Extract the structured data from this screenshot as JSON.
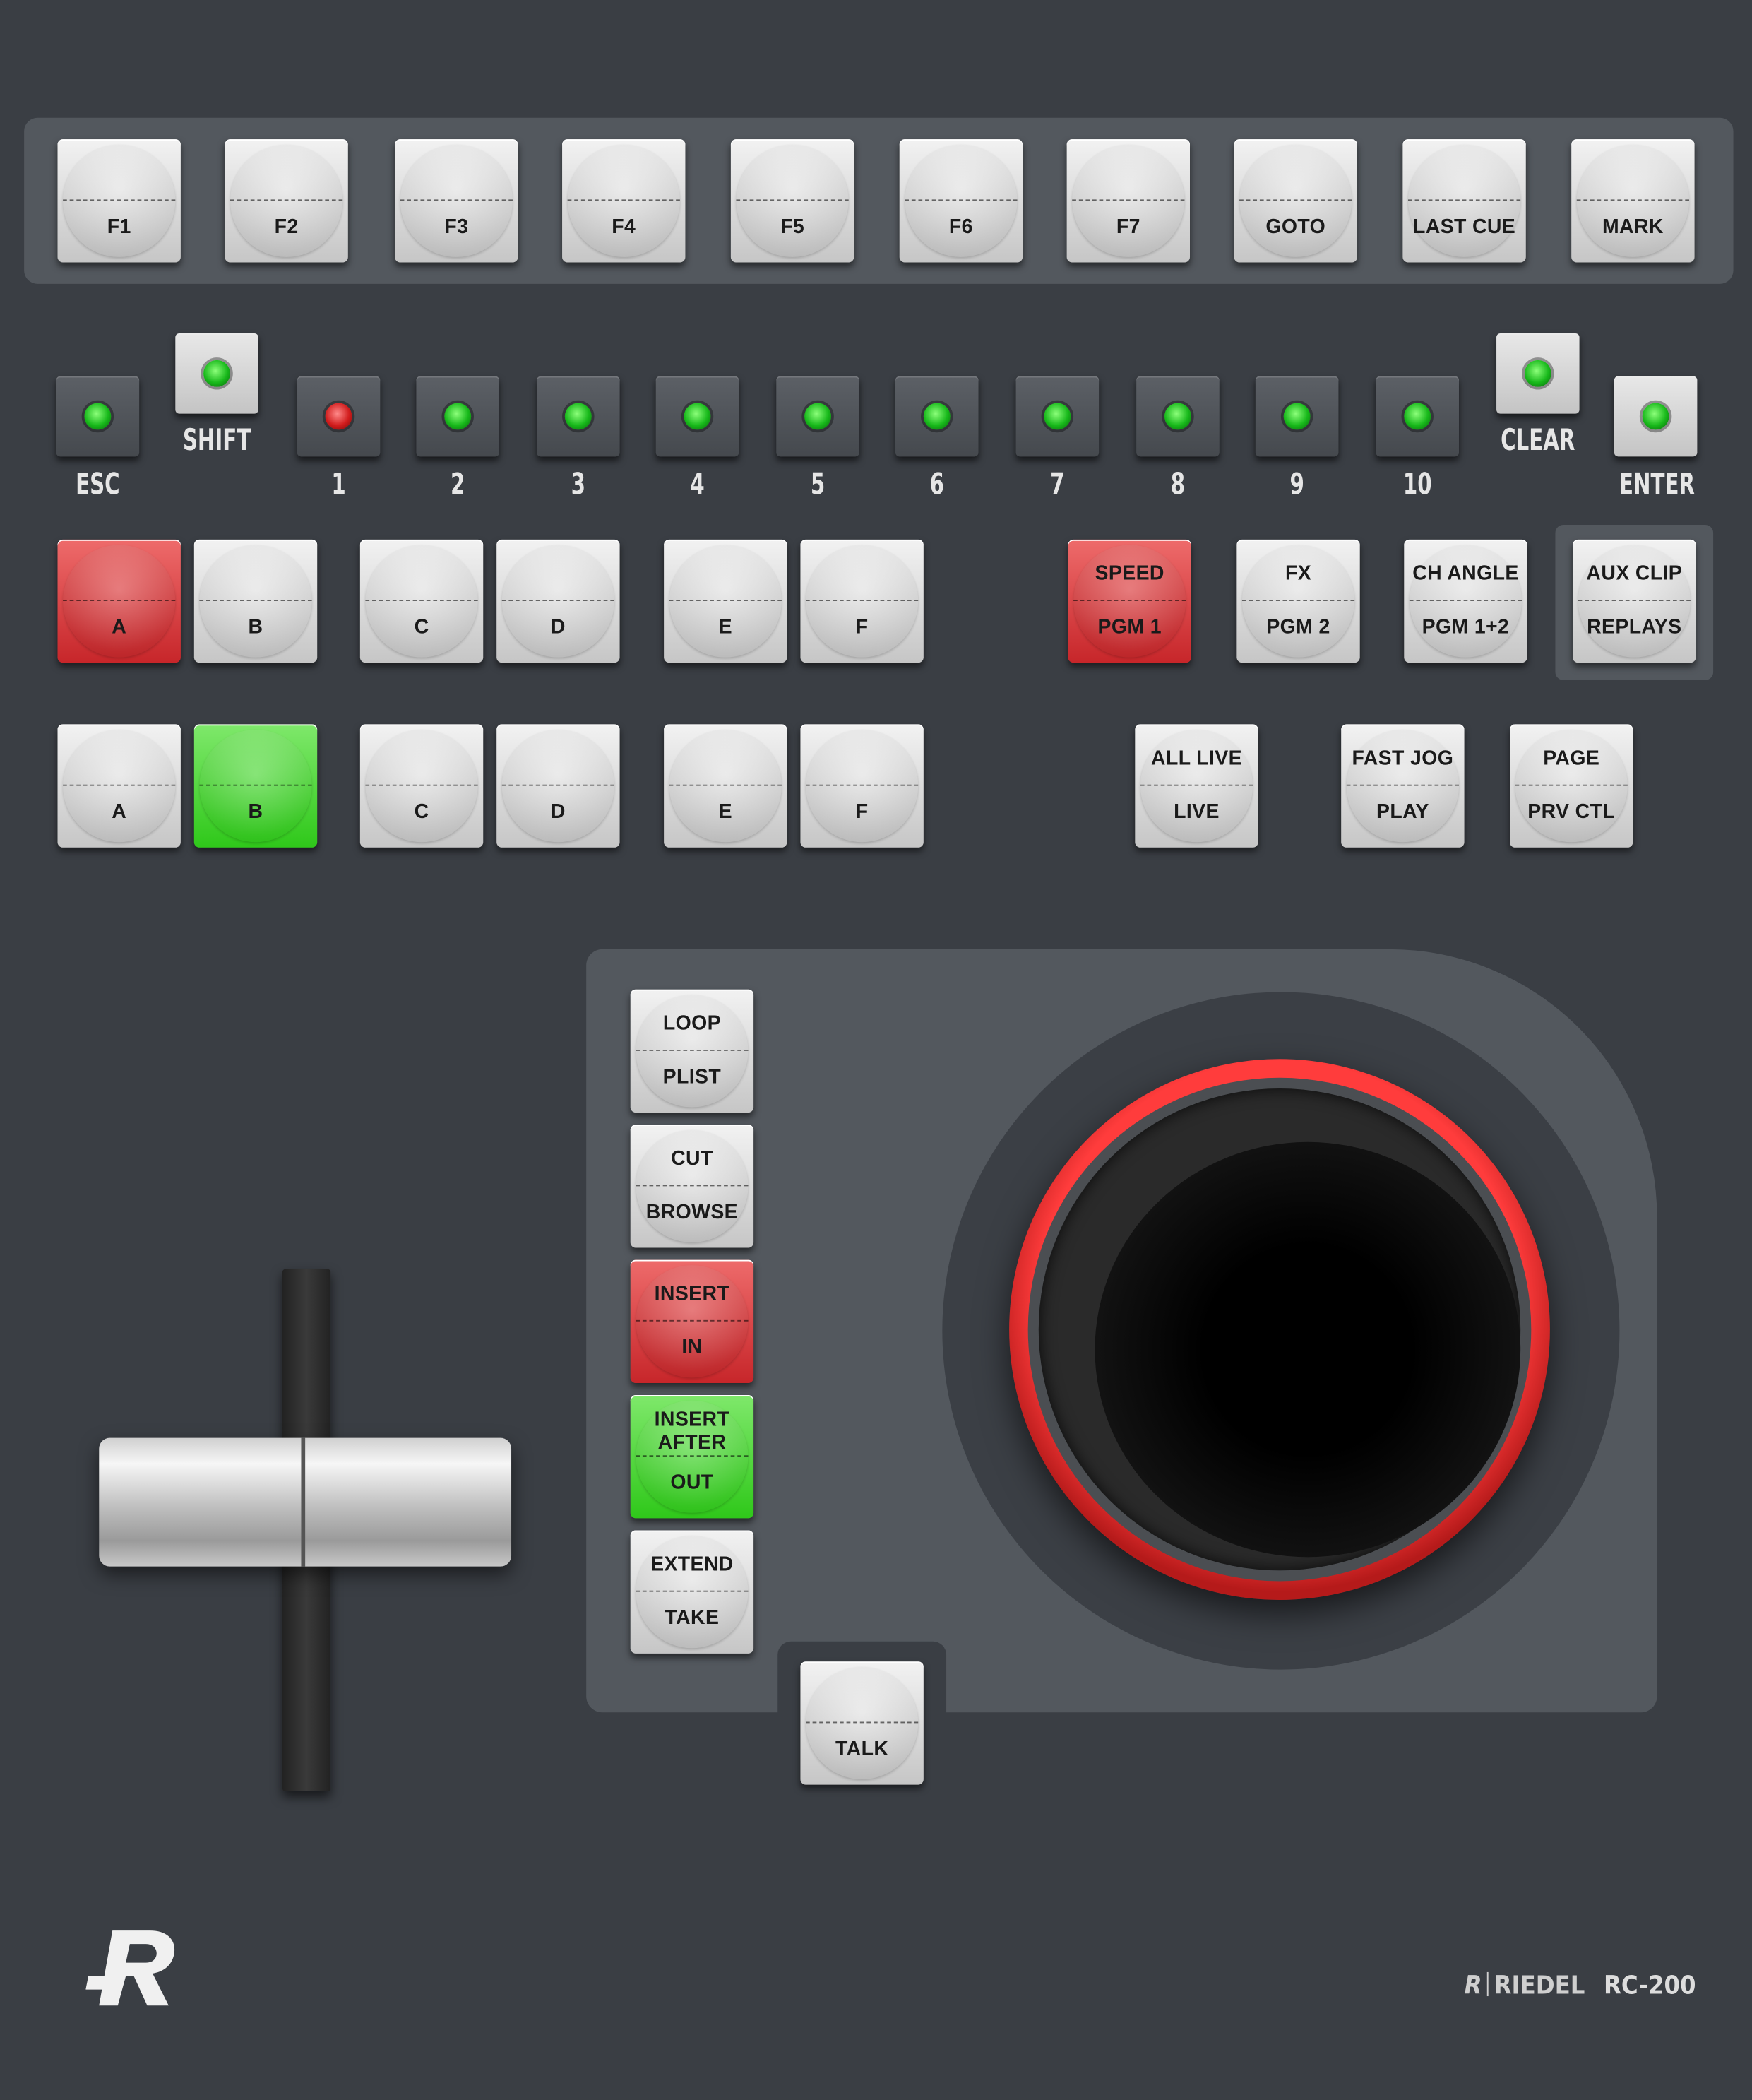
{
  "fkeys": [
    "F1",
    "F2",
    "F3",
    "F4",
    "F5",
    "F6",
    "F7",
    "GOTO",
    "LAST CUE",
    "MARK"
  ],
  "led_keys": [
    {
      "label": "ESC",
      "lit": "green",
      "style": "dark"
    },
    {
      "label": "SHIFT",
      "lit": "green",
      "style": "light"
    },
    {
      "label": "1",
      "lit": "red",
      "style": "dark"
    },
    {
      "label": "2",
      "lit": "green",
      "style": "dark"
    },
    {
      "label": "3",
      "lit": "green",
      "style": "dark"
    },
    {
      "label": "4",
      "lit": "green",
      "style": "dark"
    },
    {
      "label": "5",
      "lit": "green",
      "style": "dark"
    },
    {
      "label": "6",
      "lit": "green",
      "style": "dark"
    },
    {
      "label": "7",
      "lit": "green",
      "style": "dark"
    },
    {
      "label": "8",
      "lit": "green",
      "style": "dark"
    },
    {
      "label": "9",
      "lit": "green",
      "style": "dark"
    },
    {
      "label": "10",
      "lit": "green",
      "style": "dark"
    },
    {
      "label": "CLEAR",
      "lit": "green",
      "style": "light"
    },
    {
      "label": "ENTER",
      "lit": "green",
      "style": "light"
    }
  ],
  "row_a": [
    {
      "label": "A",
      "state": "red"
    },
    {
      "label": "B",
      "state": "off"
    },
    {
      "label": "C",
      "state": "off"
    },
    {
      "label": "D",
      "state": "off"
    },
    {
      "label": "E",
      "state": "off"
    },
    {
      "label": "F",
      "state": "off"
    }
  ],
  "row_a_right": [
    {
      "top": "SPEED",
      "bottom": "PGM 1",
      "state": "red"
    },
    {
      "top": "FX",
      "bottom": "PGM 2",
      "state": "off"
    },
    {
      "top": "CH ANGLE",
      "bottom": "PGM 1+2",
      "state": "off"
    },
    {
      "top": "AUX CLIP",
      "bottom": "REPLAYS",
      "state": "off"
    }
  ],
  "row_b": [
    {
      "label": "A",
      "state": "off"
    },
    {
      "label": "B",
      "state": "green"
    },
    {
      "label": "C",
      "state": "off"
    },
    {
      "label": "D",
      "state": "off"
    },
    {
      "label": "E",
      "state": "off"
    },
    {
      "label": "F",
      "state": "off"
    }
  ],
  "row_b_right": [
    {
      "top": "ALL LIVE",
      "bottom": "LIVE",
      "state": "off"
    },
    {
      "top": "FAST JOG",
      "bottom": "PLAY",
      "state": "off"
    },
    {
      "top": "PAGE",
      "bottom": "PRV CTL",
      "state": "off"
    }
  ],
  "jog_keys": [
    {
      "top": "LOOP",
      "bottom": "PLIST",
      "state": "off"
    },
    {
      "top": "CUT",
      "bottom": "BROWSE",
      "state": "off"
    },
    {
      "top": "INSERT",
      "bottom": "IN",
      "state": "red"
    },
    {
      "top": "INSERT AFTER",
      "bottom": "OUT",
      "state": "green"
    },
    {
      "top": "EXTEND",
      "bottom": "TAKE",
      "state": "off"
    }
  ],
  "talk": "TALK",
  "brand": {
    "name": "RIEDEL",
    "model": "RC-200"
  },
  "colors": {
    "panel": "#3a3e44",
    "accent_red": "#e32b2b",
    "accent_green": "#3ad12a",
    "led_green": "#17b81a",
    "led_red": "#d11c1c"
  },
  "icons": {
    "logo": "riedel-r-logo",
    "fader": "t-bar-fader",
    "jog": "jog-shuttle-wheel"
  }
}
